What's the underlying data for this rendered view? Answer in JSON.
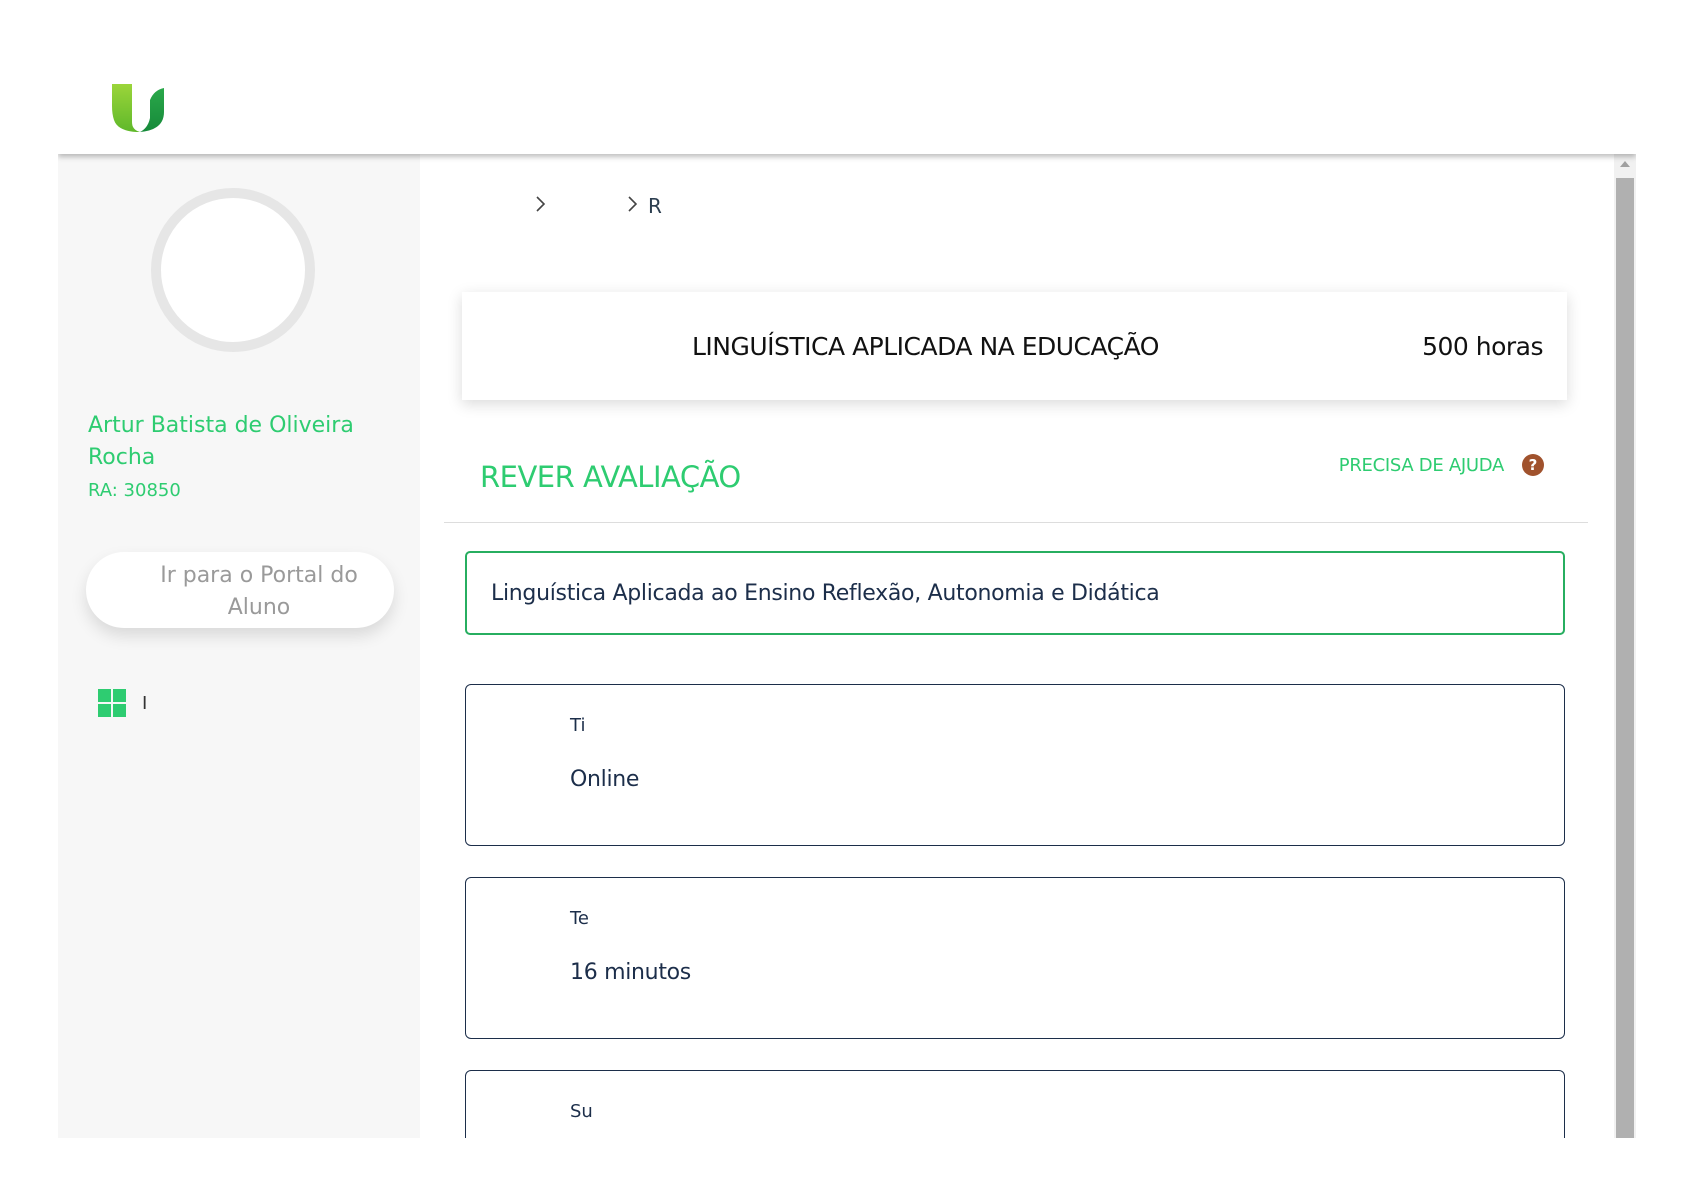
{
  "sidebar": {
    "user_name": "Artur Batista de Oliveira Rocha",
    "user_ra": "RA: 30850",
    "portal_button": "Ir para o Portal do Aluno",
    "menu_items": [
      {
        "icon": "dashboard-icon",
        "label": "I"
      }
    ]
  },
  "breadcrumb": {
    "items": [
      "",
      "",
      "R"
    ]
  },
  "course": {
    "title": "LINGUÍSTICA APLICADA NA EDUCAÇÃO",
    "hours": "500 horas"
  },
  "section": {
    "title": "REVER AVALIAÇÃO",
    "help_label": "PRECISA DE AJUDA",
    "help_icon_glyph": "?"
  },
  "activity": {
    "title": "Linguística Aplicada ao Ensino Reflexão, Autonomia e Didática"
  },
  "info_boxes": [
    {
      "label": "Ti",
      "value": "Online"
    },
    {
      "label": "Te",
      "value": "16 minutos"
    },
    {
      "label": "Su",
      "value": ""
    }
  ],
  "colors": {
    "accent_green": "#2ecc71",
    "activity_border": "#27ae60",
    "dark_text": "#1c2e4a",
    "help_icon": "#a0522d"
  }
}
